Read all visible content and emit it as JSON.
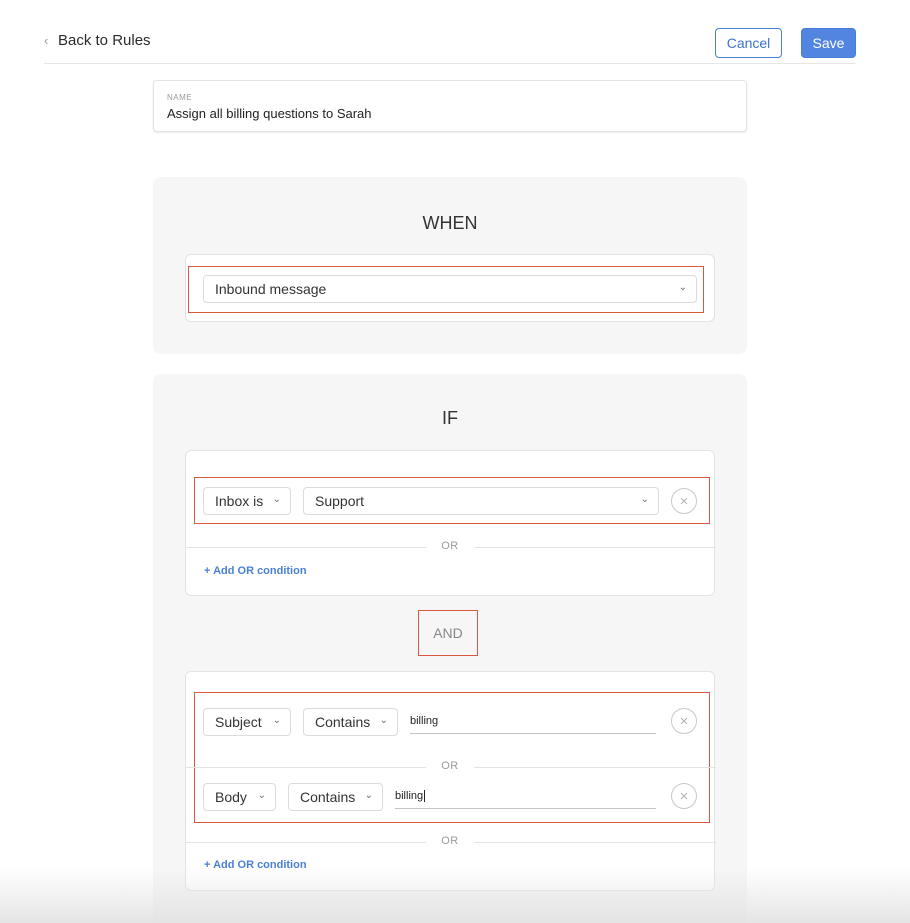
{
  "header": {
    "back_label": "Back to Rules",
    "back_icon": "chevron-left-icon",
    "cancel_label": "Cancel",
    "save_label": "Save"
  },
  "rule": {
    "name_label": "NAME",
    "name_value": "Assign all billing questions to Sarah"
  },
  "when": {
    "title": "WHEN",
    "trigger": "Inbound message"
  },
  "if": {
    "title": "IF",
    "group1": {
      "field": "Inbox is",
      "value": "Support",
      "or_label": "OR",
      "add_or": "+ Add OR condition"
    },
    "and_label": "AND",
    "group2": {
      "row1": {
        "field": "Subject",
        "operator": "Contains",
        "value": "billing"
      },
      "or_label": "OR",
      "row2": {
        "field": "Body",
        "operator": "Contains",
        "value": "billing"
      },
      "or_label2": "OR",
      "add_or": "+ Add OR condition"
    }
  },
  "colors": {
    "accent": "#4a7fd6",
    "highlight": "#d9583e",
    "panel_bg": "#f6f6f6"
  }
}
